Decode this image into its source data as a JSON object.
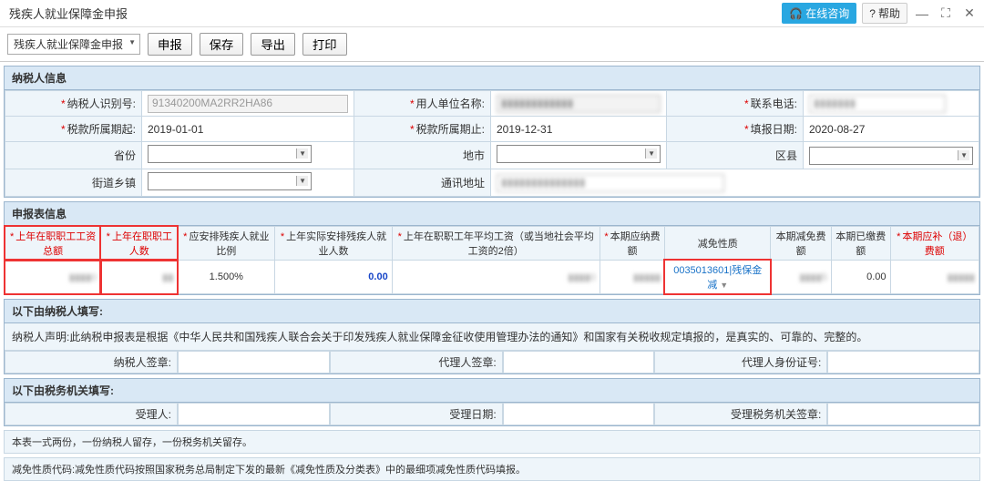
{
  "window": {
    "title": "残疾人就业保障金申报"
  },
  "titlebar": {
    "consult": "在线咨询",
    "help": "帮助"
  },
  "toolbar": {
    "tab": "残疾人就业保障金申报",
    "declare": "申报",
    "save": "保存",
    "export": "导出",
    "print": "打印"
  },
  "sections": {
    "taxpayer": "纳税人信息",
    "form": "申报表信息",
    "fill_taxpayer": "以下由纳税人填写:",
    "fill_tax_org": "以下由税务机关填写:"
  },
  "labels": {
    "taxpayer_id": "纳税人识别号:",
    "employer": "用人单位名称:",
    "phone": "联系电话:",
    "period_from": "税款所属期起:",
    "period_to": "税款所属期止:",
    "report_date": "填报日期:",
    "province": "省份",
    "city": "地市",
    "district": "区县",
    "street": "街道乡镇",
    "addr": "通讯地址",
    "sign_taxpayer": "纳税人签章:",
    "sign_agent": "代理人签章:",
    "agent_id": "代理人身份证号:",
    "approver": "受理人:",
    "approve_date": "受理日期:",
    "approve_org_sign": "受理税务机关签章:"
  },
  "values": {
    "taxpayer_id": "91340200MA2RR2HA86",
    "period_from": "2019-01-01",
    "period_to": "2019-12-31",
    "report_date": "2020-08-27",
    "ratio": "1.500%",
    "actual_num": "0.00",
    "exempt_type": "0035013601|残保金减",
    "paid": "0.00"
  },
  "blurred": {
    "employer": "▮▮▮▮▮▮▮▮▮▮▮▮",
    "phone": "▮▮▮▮▮▮▮",
    "addr": "▮▮▮▮▮▮▮▮▮▮▮▮▮▮",
    "c1": "▮▮▮▮0",
    "c2": "▮▮",
    "avg_wage": "▮▮▮▮0",
    "due": "▮▮▮▮▮",
    "reduce": "▮▮▮▮5",
    "refund": "▮▮▮▮▮"
  },
  "cols": {
    "c1": "上年在职职工工资总额",
    "c2": "上年在职职工人数",
    "c3": "应安排残疾人就业比例",
    "c4": "上年实际安排残疾人就业人数",
    "c5": "上年在职职工年平均工资（或当地社会平均工资的2倍）",
    "c6": "本期应纳费额",
    "c7": "减免性质",
    "c8": "本期减免费额",
    "c9": "本期已缴费额",
    "c10": "本期应补（退）费额"
  },
  "notes": {
    "decl": "纳税人声明:此纳税申报表是根据《中华人民共和国残疾人联合会关于印发残疾人就业保障金征收使用管理办法的通知》和国家有关税收规定填报的，是真实的、可靠的、完整的。",
    "copies": "本表一式两份，一份纳税人留存，一份税务机关留存。",
    "code": "减免性质代码:减免性质代码按照国家税务总局制定下发的最新《减免性质及分类表》中的最细项减免性质代码填报。"
  }
}
